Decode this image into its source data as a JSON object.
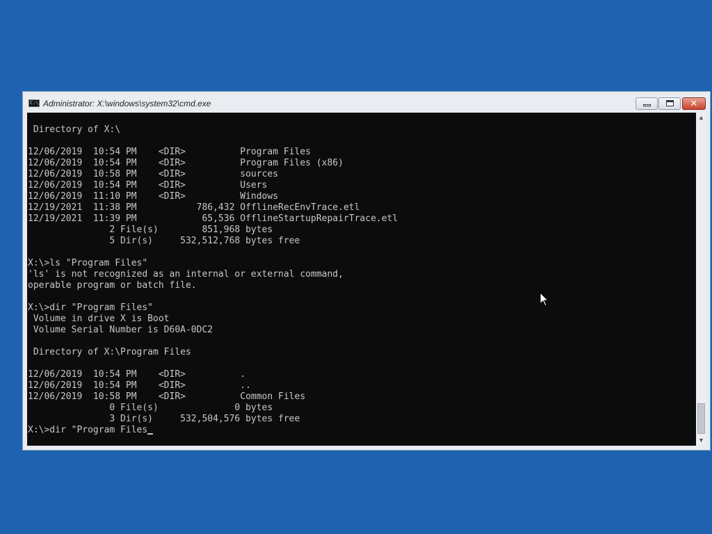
{
  "window": {
    "title": "Administrator: X:\\windows\\system32\\cmd.exe",
    "icon": "cmd-icon",
    "icon_text": "C:\\"
  },
  "controls": {
    "minimize_icon": "minimize-icon",
    "maximize_icon": "maximize-icon",
    "close_icon": "close-icon",
    "close_glyph": "✕"
  },
  "console": {
    "lines": [
      " Directory of X:\\",
      "",
      "12/06/2019  10:54 PM    <DIR>          Program Files",
      "12/06/2019  10:54 PM    <DIR>          Program Files (x86)",
      "12/06/2019  10:58 PM    <DIR>          sources",
      "12/06/2019  10:54 PM    <DIR>          Users",
      "12/06/2019  11:10 PM    <DIR>          Windows",
      "12/19/2021  11:38 PM           786,432 OfflineRecEnvTrace.etl",
      "12/19/2021  11:39 PM            65,536 OfflineStartupRepairTrace.etl",
      "               2 File(s)        851,968 bytes",
      "               5 Dir(s)     532,512,768 bytes free",
      "",
      "X:\\>ls \"Program Files\"",
      "'ls' is not recognized as an internal or external command,",
      "operable program or batch file.",
      "",
      "X:\\>dir \"Program Files\"",
      " Volume in drive X is Boot",
      " Volume Serial Number is D60A-0DC2",
      "",
      " Directory of X:\\Program Files",
      "",
      "12/06/2019  10:54 PM    <DIR>          .",
      "12/06/2019  10:54 PM    <DIR>          ..",
      "12/06/2019  10:58 PM    <DIR>          Common Files",
      "               0 File(s)              0 bytes",
      "               3 Dir(s)     532,504,576 bytes free",
      ""
    ],
    "prompt_input": "X:\\>dir \"Program Files",
    "text_color": "#c8c8c8",
    "background_color": "#0c0c0c"
  },
  "scrollbar": {
    "up_arrow": "▲",
    "down_arrow": "▼",
    "position_fraction": 1.0
  },
  "desktop": {
    "background_color": "#1f62b0"
  }
}
